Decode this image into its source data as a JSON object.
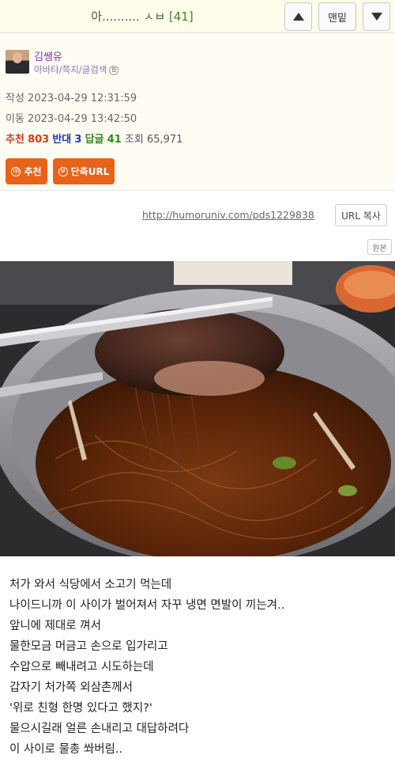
{
  "header": {
    "title_prefix": "아.......... ㅅㅂ ",
    "comment_count": "[41]",
    "bottom_label": "맨밑"
  },
  "author": {
    "nickname": "김쌩유",
    "links": "아바타/쪽지/글검색",
    "badge": "B"
  },
  "meta": {
    "posted": "작성 2023-04-29 12:31:59",
    "moved": "이동 2023-04-29 13:42:50"
  },
  "stats": {
    "recommend_label": "추천",
    "recommend_value": "803",
    "oppose_label": "반대",
    "oppose_value": "3",
    "reply_label": "답글",
    "reply_value": "41",
    "views_label": "조회",
    "views_value": "65,971"
  },
  "actions": {
    "recommend_button": "추천",
    "short_url_button": "단축URL"
  },
  "url": {
    "link": "http://humoruniv.com/pds1229838",
    "copy_button": "URL 복사",
    "original_button": "원본"
  },
  "content": {
    "lines": [
      "처가 와서 식당에서 소고기 먹는데",
      "나이드니까 이 사이가 벌어져서 자꾸 냉면 면발이 끼는겨..",
      "앞니에 제대로 껴서",
      "물한모금 머금고 손으로 입가리고",
      "수압으로 빼내려고 시도하는데",
      "갑자기 처가쪽 외삼촌께서",
      "'위로 친형 한명 있다고 했지?'",
      "물으시길래 얼른 손내리고 대답하려다",
      "이 사이로 물총 쏴버림.."
    ]
  },
  "colors": {
    "accent_orange": "#e8621a",
    "title_count": "#3a8a2a",
    "nickname": "#7a3aa8"
  },
  "icons": {
    "up": "triangle-up-icon",
    "down": "triangle-down-icon"
  }
}
